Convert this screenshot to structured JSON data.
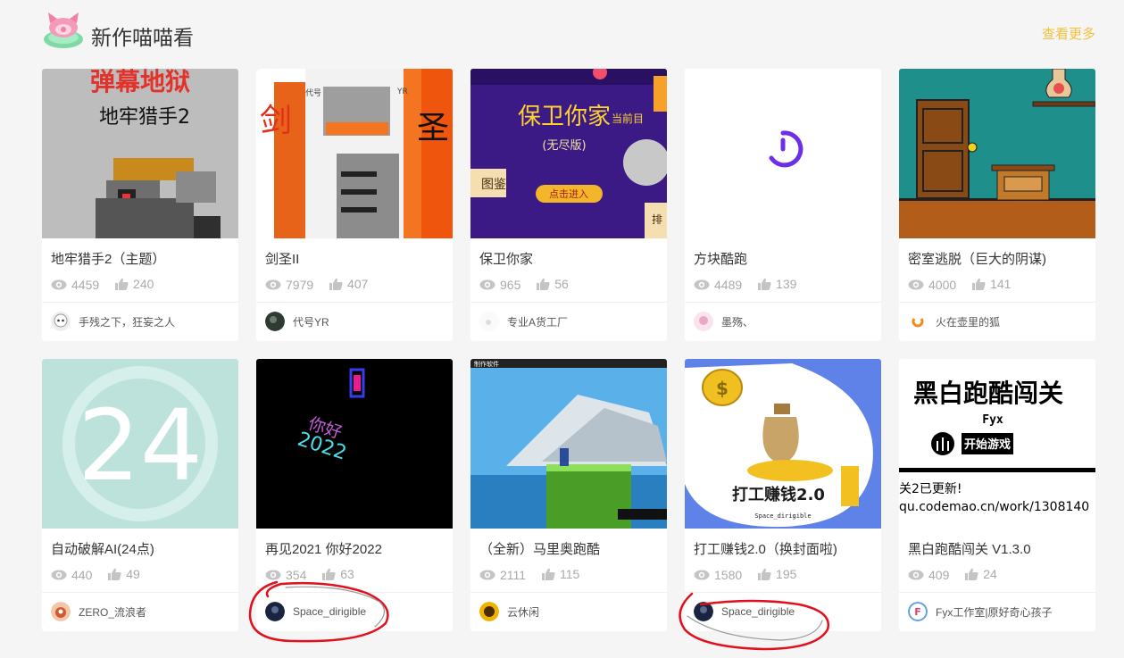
{
  "section": {
    "title": "新作喵喵看",
    "more_label": "查看更多"
  },
  "works": [
    {
      "title": "地牢猎手2（主题）",
      "views": "4459",
      "likes": "240",
      "author": "手残之下，狂妄之人",
      "thumb_text": [
        "弹幕地狱",
        "地牢猎手2"
      ]
    },
    {
      "title": "剑圣II",
      "views": "7979",
      "likes": "407",
      "author": "代号YR",
      "thumb_text": [
        "剑",
        "圣",
        "代号",
        "YR"
      ]
    },
    {
      "title": "保卫你家",
      "views": "965",
      "likes": "56",
      "author": "专业A货工厂",
      "thumb_text": [
        "保卫你家",
        "(无尽版)",
        "当前目",
        "点击进入",
        "图鉴",
        "排"
      ]
    },
    {
      "title": "方块酷跑",
      "views": "4489",
      "likes": "139",
      "author": "墨殇、",
      "thumb_text": []
    },
    {
      "title": "密室逃脱（巨大的阴谋)",
      "views": "4000",
      "likes": "141",
      "author": "火在壶里的狐",
      "thumb_text": []
    },
    {
      "title": "自动破解AI(24点)",
      "views": "440",
      "likes": "49",
      "author": "ZERO_流浪者",
      "thumb_text": [
        "24"
      ]
    },
    {
      "title": "再见2021 你好2022",
      "views": "354",
      "likes": "63",
      "author": "Space_dirigible",
      "thumb_text": [
        "你好",
        "2022"
      ]
    },
    {
      "title": "（全新）马里奥跑酷",
      "views": "2111",
      "likes": "115",
      "author": "云休闲",
      "thumb_text": [
        "制作软件"
      ]
    },
    {
      "title": "打工赚钱2.0（换封面啦)",
      "views": "1580",
      "likes": "195",
      "author": "Space_dirigible",
      "thumb_text": [
        "打工赚钱2.0",
        "Space_dirigible",
        "$"
      ]
    },
    {
      "title": "黑白跑酷闯关 V1.3.0",
      "views": "409",
      "likes": "24",
      "author": "Fyx工作室|原好奇心孩子",
      "thumb_text": [
        "黑白跑酷闯关",
        "Fyx",
        "开始游戏",
        "关2已更新!",
        "qu.codemao.cn/work/1308140"
      ]
    }
  ],
  "colors": {
    "accent": "#f5c13c",
    "scribble": "#e0101c",
    "text": "#333333",
    "muted": "#aaaaaa"
  }
}
